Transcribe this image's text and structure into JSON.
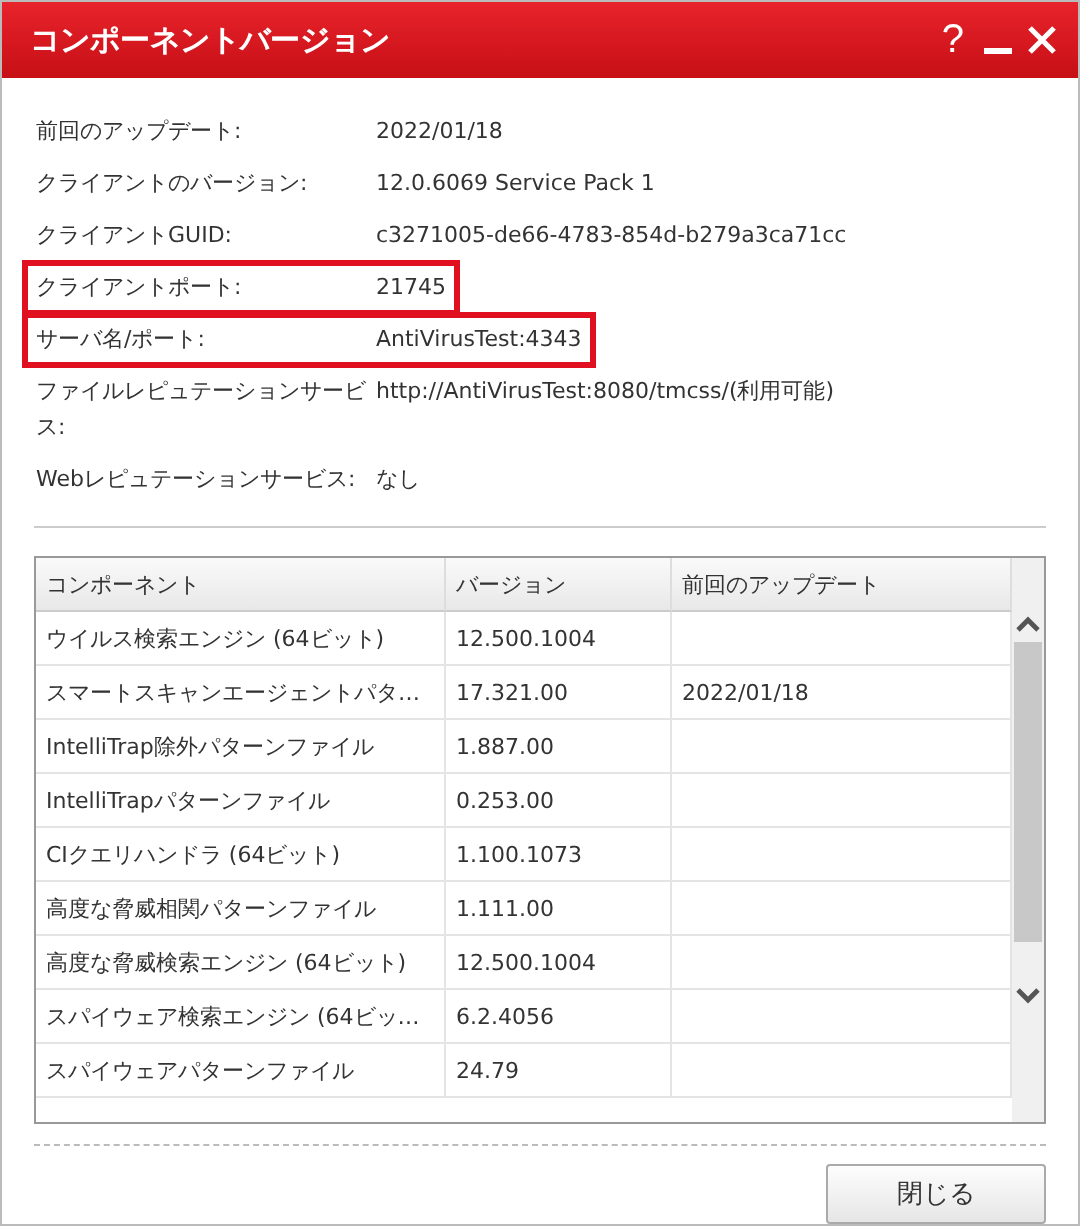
{
  "window": {
    "title": "コンポーネントバージョン",
    "help": "?"
  },
  "info": [
    {
      "label": "前回のアップデート:",
      "value": "2022/01/18",
      "highlighted": false
    },
    {
      "label": "クライアントのバージョン:",
      "value": "12.0.6069 Service Pack 1",
      "highlighted": false
    },
    {
      "label": "クライアントGUID:",
      "value": "c3271005-de66-4783-854d-b279a3ca71cc",
      "highlighted": false
    },
    {
      "label": "クライアントポート:",
      "value": "21745",
      "highlighted": true
    },
    {
      "label": "サーバ名/ポート:",
      "value": "AntiVirusTest:4343",
      "highlighted": true
    },
    {
      "label": "ファイルレピュテーションサービス:",
      "value": "http://AntiVirusTest:8080/tmcss/(利用可能)",
      "highlighted": false
    },
    {
      "label": "Webレピュテーションサービス:",
      "value": "なし",
      "highlighted": false
    }
  ],
  "table": {
    "columns": [
      "コンポーネント",
      "バージョン",
      "前回のアップデート"
    ],
    "rows": [
      [
        "ウイルス検索エンジン (64ビット)",
        "12.500.1004",
        ""
      ],
      [
        "スマートスキャンエージェントパタ…",
        "17.321.00",
        "2022/01/18"
      ],
      [
        "IntelliTrap除外パターンファイル",
        "1.887.00",
        ""
      ],
      [
        "IntelliTrapパターンファイル",
        "0.253.00",
        ""
      ],
      [
        "CIクエリハンドラ (64ビット)",
        "1.100.1073",
        ""
      ],
      [
        "高度な脅威相関パターンファイル",
        "1.111.00",
        ""
      ],
      [
        "高度な脅威検索エンジン (64ビット)",
        "12.500.1004",
        ""
      ],
      [
        "スパイウェア検索エンジン (64ビッ…",
        "6.2.4056",
        ""
      ],
      [
        "スパイウェアパターンファイル",
        "24.79",
        ""
      ]
    ]
  },
  "buttons": [
    "閉じる"
  ]
}
